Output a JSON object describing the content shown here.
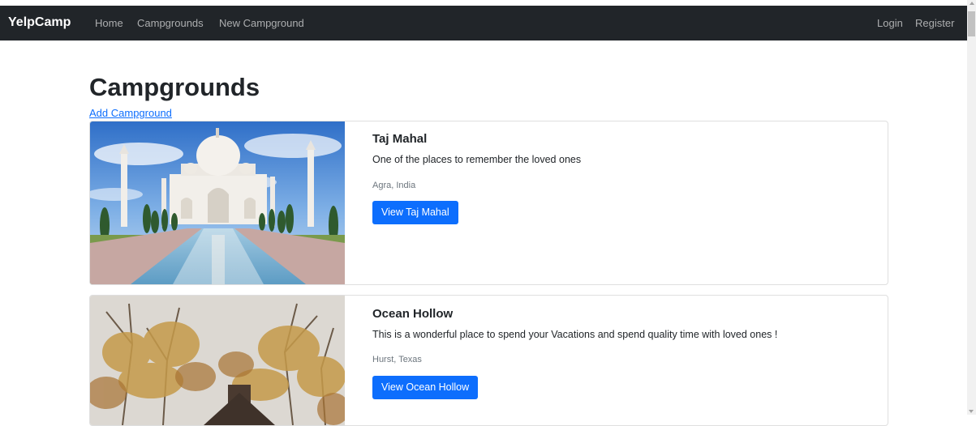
{
  "navbar": {
    "brand": "YelpCamp",
    "links": [
      "Home",
      "Campgrounds",
      "New Campground"
    ],
    "right_links": [
      "Login",
      "Register"
    ],
    "bg_color": "#212529"
  },
  "main": {
    "title": "Campgrounds",
    "add_link": "Add Campground",
    "cards": [
      {
        "title": "Taj Mahal",
        "description": "One of the places to remember the loved ones",
        "location": "Agra, India",
        "button": "View Taj Mahal",
        "image": "taj-mahal-photo"
      },
      {
        "title": "Ocean Hollow",
        "description": "This is a wonderful place to spend your Vacations and spend quality time with loved ones !",
        "location": "Hurst, Texas",
        "button": "View Ocean Hollow",
        "image": "autumn-forest-cabin-photo"
      }
    ]
  },
  "accent_color": "#0d6efd"
}
